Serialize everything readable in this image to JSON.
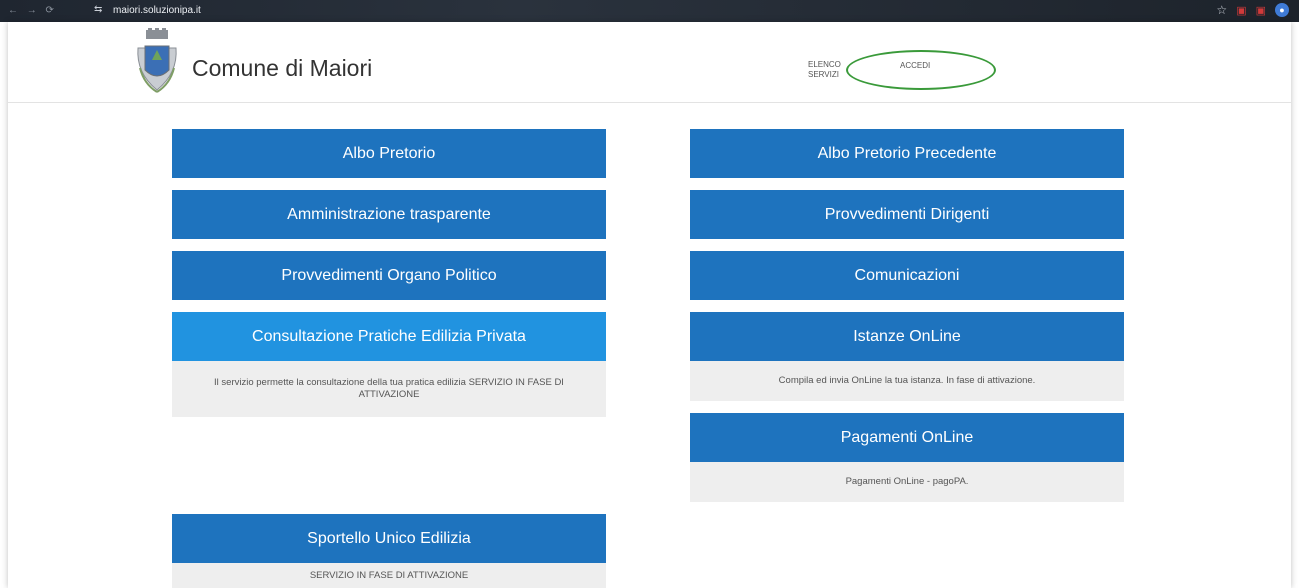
{
  "browser": {
    "url": "maiori.soluzionipa.it",
    "nav_glyphs": "← → ⟳",
    "site_icon": "⇆",
    "star_glyph": "☆",
    "extension_glyph": "▣",
    "profile_glyph": "●"
  },
  "header": {
    "title": "Comune di Maiori",
    "nav_elenco": "ELENCO SERVIZI",
    "nav_accedi": "ACCEDI"
  },
  "colors": {
    "tile_blue": "#1e73be",
    "tile_light_blue": "#2193e0",
    "annotation_green": "#3a9a3a"
  },
  "tiles_left": [
    {
      "label": "Albo Pretorio"
    },
    {
      "label": "Amministrazione trasparente"
    },
    {
      "label": "Provvedimenti Organo Politico"
    },
    {
      "label": "Consultazione Pratiche Edilizia Privata",
      "description": "Il servizio permette la consultazione della tua pratica edilizia SERVIZIO IN FASE DI ATTIVAZIONE"
    },
    {
      "label": "Sportello Unico Edilizia",
      "description": "SERVIZIO IN FASE DI ATTIVAZIONE"
    }
  ],
  "tiles_right": [
    {
      "label": "Albo Pretorio Precedente"
    },
    {
      "label": "Provvedimenti Dirigenti"
    },
    {
      "label": "Comunicazioni"
    },
    {
      "label": "Istanze OnLine",
      "description": "Compila ed invia OnLine la tua istanza. In fase di attivazione."
    },
    {
      "label": "Pagamenti OnLine",
      "description": "Pagamenti OnLine - pagoPA."
    }
  ]
}
